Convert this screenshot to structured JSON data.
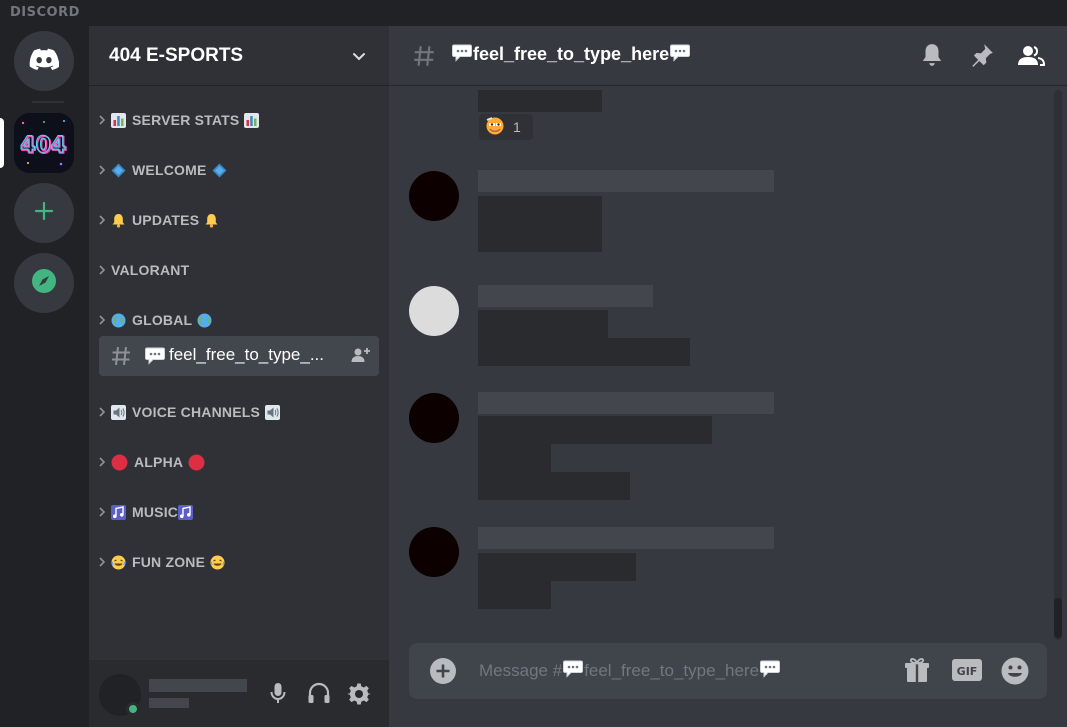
{
  "app": {
    "title": "DISCORD"
  },
  "servers": {
    "home_icon": "discord-logo-icon",
    "guild_icon_text": "404",
    "add_icon": "plus-icon",
    "explore_icon": "compass-icon"
  },
  "guild": {
    "name": "404 E-SPORTS"
  },
  "categories": [
    {
      "label": "SERVER STATS",
      "emoji": "bar-chart-icon"
    },
    {
      "label": "WELCOME",
      "emoji": "blue-diamond-icon"
    },
    {
      "label": "UPDATES",
      "emoji": "bell-icon"
    },
    {
      "label": "VALORANT",
      "emoji": ""
    },
    {
      "label": "GLOBAL",
      "emoji": "globe-icon"
    },
    {
      "label": "VOICE CHANNELS",
      "emoji": "speaker-icon"
    },
    {
      "label": "ALPHA",
      "emoji": "red-circle-icon"
    },
    {
      "label": "MUSIC",
      "emoji": "music-note-icon"
    },
    {
      "label": "FUN ZONE",
      "emoji": "laughing-emoji-icon"
    }
  ],
  "selected_channel": {
    "label": "feel_free_to_type_..."
  },
  "header": {
    "channel": "feel_free_to_type_here"
  },
  "reaction": {
    "count": "1"
  },
  "composer": {
    "placeholder_prefix": "Message #",
    "placeholder_channel": "feel_free_to_type_here"
  },
  "colors": {
    "accent_green": "#43b581",
    "background": "#36393f",
    "sidebar": "#2f3136",
    "rail": "#202225",
    "selected": "#42464d",
    "alpha_red": "#dd2e44"
  }
}
